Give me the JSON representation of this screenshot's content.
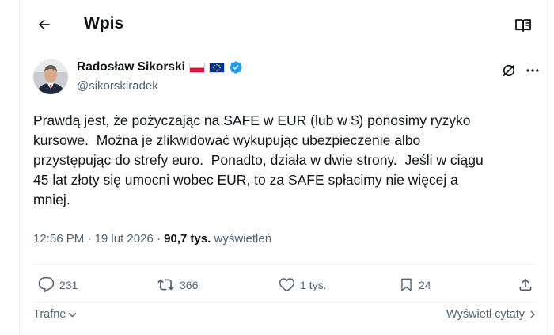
{
  "header": {
    "title": "Wpis"
  },
  "author": {
    "name": "Radosław Sikorski",
    "handle": "@sikorskiradek"
  },
  "tweet": {
    "lines": [
      "Prawdą jest, że pożyczając na SAFE w EUR (lub w $) ponosimy ryzyko",
      "kursowe.  Można je zlikwidować wykupując ubezpieczenie albo",
      "przystępując do strefy euro.  Ponadto, działa w dwie strony.  Jeśli w ciągu",
      "45 lat złoty się umocni wobec EUR, to za SAFE spłacimy nie więcej a",
      "mniej."
    ],
    "time": "12:56 PM",
    "separator": "·",
    "date": "19 lut 2026",
    "views_count": "90,7 tys.",
    "views_label": "wyświetleń"
  },
  "actions": {
    "replies": "231",
    "reposts": "366",
    "likes": "1 tys.",
    "bookmarks": "24"
  },
  "footer": {
    "sort_label": "Trafne",
    "quotes_label": "Wyświetl cytaty"
  },
  "icons": {
    "back": "arrow-left-icon",
    "reader": "reader-mode-icon",
    "verified": "verified-badge-icon",
    "grok": "grok-icon",
    "more": "more-icon",
    "reply": "reply-icon",
    "repost": "repost-icon",
    "like": "heart-icon",
    "bookmark": "bookmark-icon",
    "share": "share-icon"
  },
  "colors": {
    "verified": "#1d9bf0",
    "text": "#0f1419",
    "secondary": "#536471",
    "border": "#eff3f4"
  }
}
